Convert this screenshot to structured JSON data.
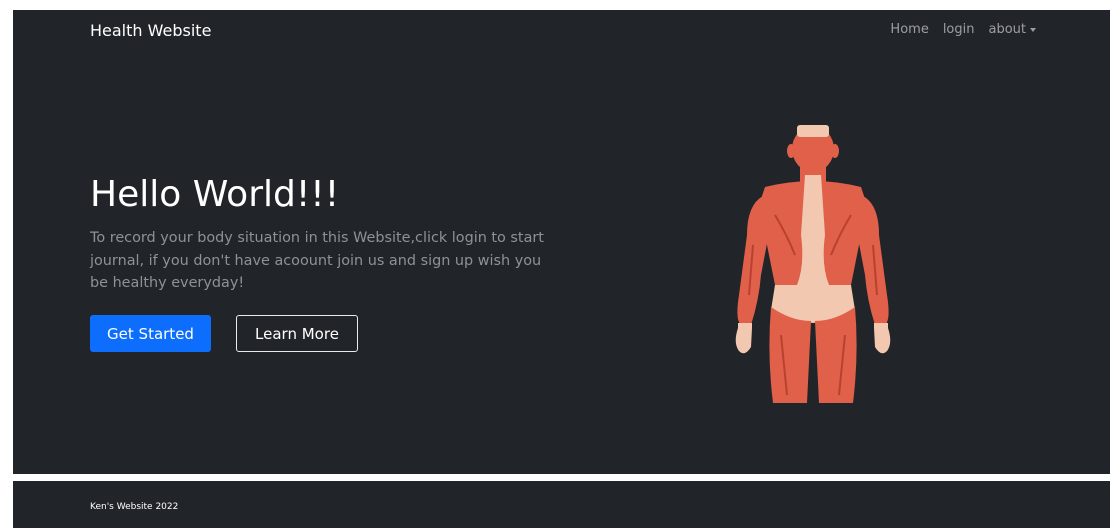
{
  "navbar": {
    "brand": "Health Website",
    "links": [
      "Home",
      "login",
      "about"
    ]
  },
  "hero": {
    "title": "Hello World!!!",
    "lead": "To record your body situation in this Website,click login to start journal, if you don't have acoount join us and sign up wish you be healthy everyday!",
    "primary_button": "Get Started",
    "secondary_button": "Learn More",
    "image": "muscular-body-back-illustration"
  },
  "footer": {
    "text": "Ken's Website 2022"
  },
  "colors": {
    "background": "#212529",
    "accent": "#0d6efd",
    "muscle": "#e0604a",
    "skin": "#f2c9b0"
  }
}
